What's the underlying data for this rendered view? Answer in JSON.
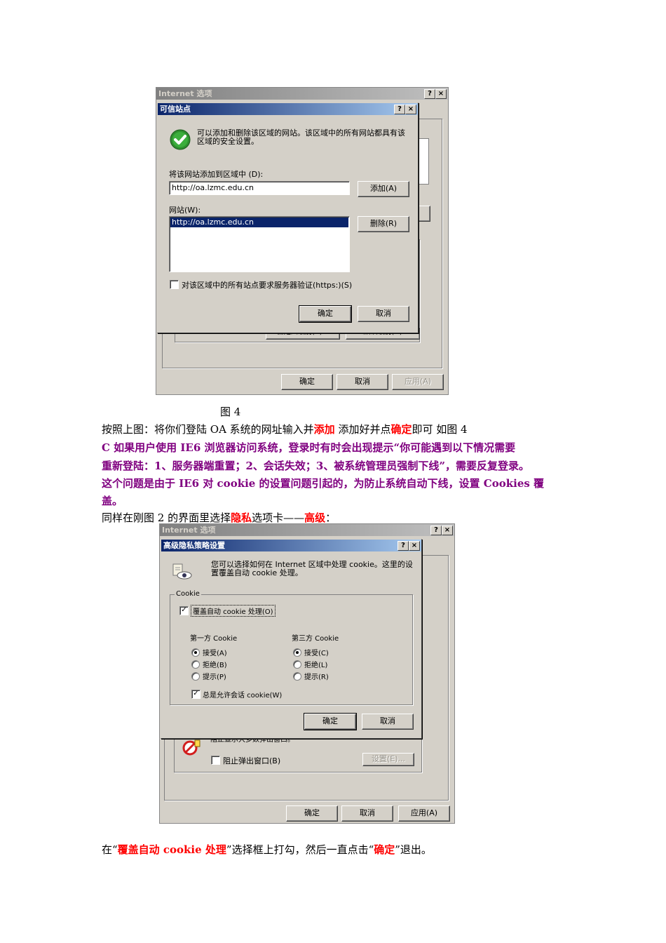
{
  "fig1": {
    "outer_title": "Internet 选项",
    "title": "可信站点",
    "help_btn": "?",
    "close_btn": "×",
    "info": "可以添加和删除该区域的网站。该区域中的所有网站都具有该区域的安全设置。",
    "add_label": "将该网站添加到区域中 (D):",
    "add_value": "http://oa.lzmc.edu.cn",
    "add_button": "添加(A)",
    "sites_label": "网站(W):",
    "sites": [
      "http://oa.lzmc.edu.cn"
    ],
    "remove_button": "删除(R)",
    "https_label": "对该区域中的所有站点要求服务器验证(https:)(S)",
    "ok": "确定",
    "cancel": "取消",
    "behind_left_btn": "自定义级别(C)...",
    "behind_right_btn": "默认级别(D)",
    "outer_ok": "确定",
    "outer_cancel": "取消",
    "outer_apply": "应用(A)"
  },
  "caption": "图 4",
  "para1": {
    "pre": "按照上图：将你们登陆 OA 系统的网址输入并",
    "w1": "添加",
    "mid": " 添加好并点",
    "w2": "确定",
    "post": "即可  如图 4"
  },
  "para_c": {
    "line1": "C  如果用户使用 IE6 浏览器访问系统，登录时有时会出现提示“你可能遇到以下情况需要",
    "line2": "重新登陆：1、服务器端重置；2、会话失效；3、被系统管理员强制下线”，需要反复登录。",
    "line3": "这个问题是由于 IE6 对 cookie 的设置问题引起的，为防止系统自动下线，设置 Cookies 覆",
    "line4": "盖。"
  },
  "para2": {
    "pre": "同样在刚图 2 的界面里选择",
    "w1": "隐私",
    "mid": "选项卡——",
    "w2": "高级",
    "post": "："
  },
  "fig2": {
    "outer_title": "Internet 选项",
    "title": "高级隐私策略设置",
    "help_btn": "?",
    "close_btn": "×",
    "info": "您可以选择如何在 Internet 区域中处理 cookie。这里的设置覆盖自动 cookie 处理。",
    "group": "Cookie",
    "override": "覆盖自动 cookie 处理(O)",
    "first_party": "第一方 Cookie",
    "third_party": "第三方 Cookie",
    "first_opts": [
      "接受(A)",
      "拒绝(B)",
      "提示(P)"
    ],
    "third_opts": [
      "接受(C)",
      "拒绝(L)",
      "提示(R)"
    ],
    "session": "总是允许会话 cookie(W)",
    "ok": "确定",
    "cancel": "取消",
    "behind_text": "阻止显示大多数弹出窗口。",
    "popup_label": "阻止弹出窗口(B)",
    "settings_btn": "设置(E)...",
    "outer_ok": "确定",
    "outer_cancel": "取消",
    "outer_apply": "应用(A)"
  },
  "final": {
    "pre": "在“",
    "w1": "覆盖自动 cookie 处理",
    "mid": "”选择框上打勾，然后一直点击“",
    "w2": "确定",
    "post": "”退出。"
  }
}
